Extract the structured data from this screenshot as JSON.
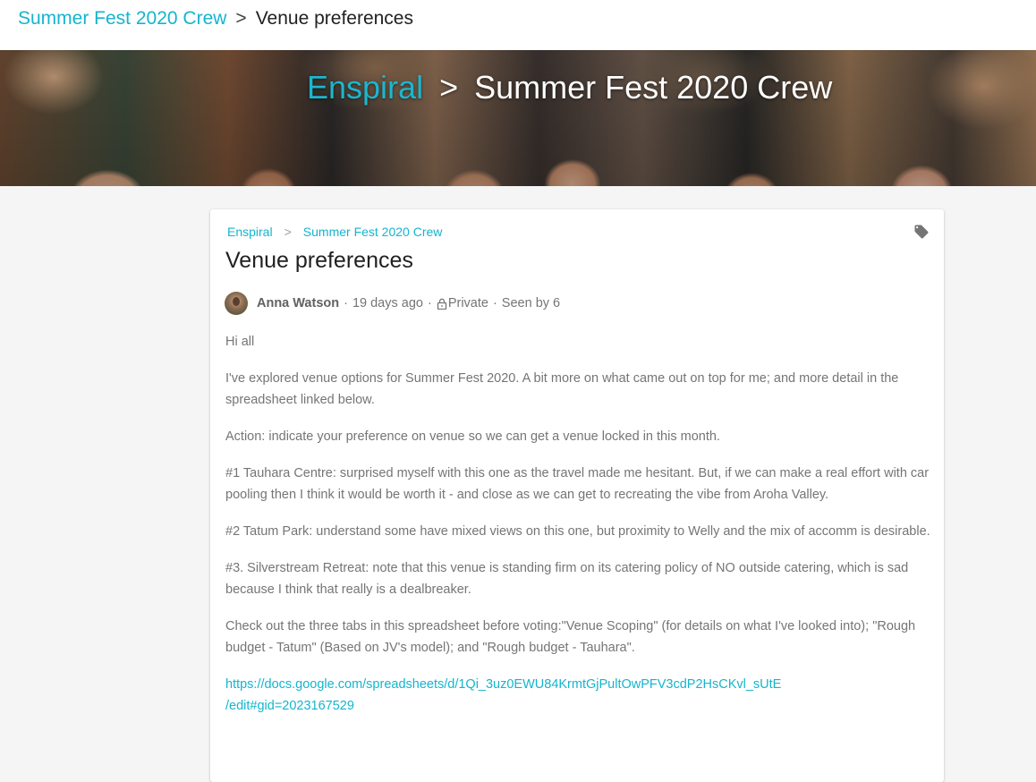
{
  "top_breadcrumb": {
    "group": "Summer Fest 2020 Crew",
    "separator": ">",
    "current": "Venue preferences"
  },
  "banner": {
    "organization": "Enspiral",
    "separator": ">",
    "group": "Summer Fest 2020 Crew"
  },
  "thread": {
    "breadcrumb": {
      "organization": "Enspiral",
      "separator": ">",
      "group": "Summer Fest 2020 Crew"
    },
    "title": "Venue preferences",
    "meta": {
      "author": "Anna Watson",
      "dot": "·",
      "time": "19 days ago",
      "privacy": "Private",
      "seen": "Seen by 6"
    },
    "body": {
      "p1": "Hi all",
      "p2": "I've explored venue options for Summer Fest 2020. A bit more on what came out on top for me; and more detail in the spreadsheet linked below.",
      "p3": "Action: indicate your preference on venue so we can get a venue locked in this month.",
      "p4": "#1 Tauhara Centre: surprised myself with this one as the travel made me hesitant. But, if we can make a real effort with car pooling then I think it would be worth it - and close as we can get to recreating the vibe from Aroha Valley.",
      "p5": "#2 Tatum Park: understand some have mixed views on this one, but proximity to Welly and the mix of accomm is desirable.",
      "p6": "#3. Silverstream Retreat: note that this venue is standing firm on its catering policy of NO outside catering, which is sad because I think that really is a dealbreaker.",
      "p7": "Check out the three tabs in this spreadsheet before voting:\"Venue Scoping\" (for details on what I've looked into); \"Rough budget - Tatum\" (Based on JV's model); and \"Rough budget - Tauhara\".",
      "link_line1": "https://docs.google.com/spreadsheets/d/1Qi_3uz0EWU84KrmtGjPultOwPFV3cdP2HsCKvl_sUtE",
      "link_line2": "/edit#gid=2023167529"
    }
  },
  "icons": {
    "tag": "tag-icon",
    "lock": "lock-icon"
  },
  "colors": {
    "accent": "#14b5ce",
    "text": "#212121",
    "muted": "#757575"
  }
}
